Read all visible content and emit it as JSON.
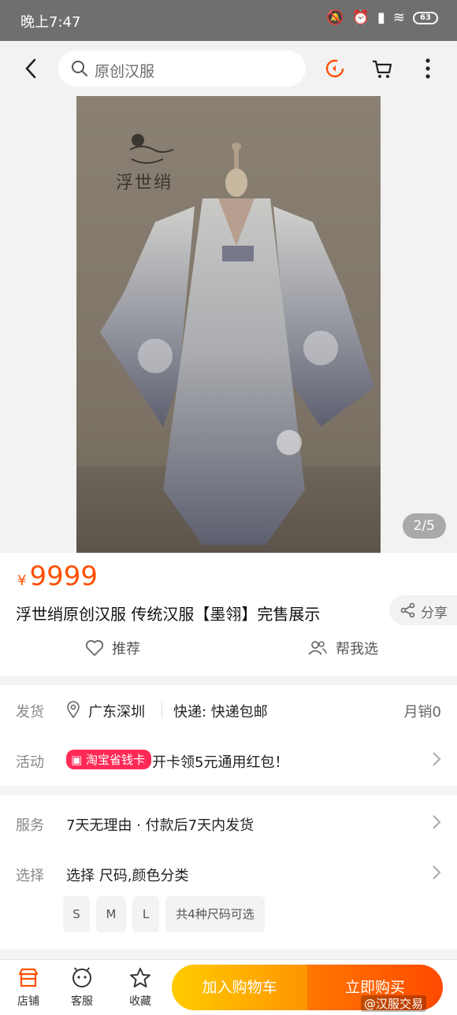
{
  "status": {
    "time": "晚上7:47",
    "battery": "63"
  },
  "search": {
    "placeholder": "原创汉服"
  },
  "hero": {
    "logo_text": "浮世绡",
    "pager": "2/5"
  },
  "product": {
    "price_symbol": "¥",
    "price": "9999",
    "title": "浮世绡原创汉服 传统汉服【墨翎】完售展示",
    "share": "分享",
    "recommend": "推荐",
    "help_choose": "帮我选"
  },
  "shipping": {
    "label": "发货",
    "location": "广东深圳",
    "express": "快递: 快递包邮",
    "monthly_sales": "月销0"
  },
  "promo": {
    "label": "活动",
    "tag": "淘宝省钱卡",
    "text": "开卡领5元通用红包！"
  },
  "service": {
    "label": "服务",
    "text": "7天无理由 · 付款后7天内发货"
  },
  "select": {
    "label": "选择",
    "text": "选择 尺码,颜色分类",
    "sizes": [
      "S",
      "M",
      "L"
    ],
    "more": "共4种尺码可选"
  },
  "bottom": {
    "store": "店铺",
    "service": "客服",
    "favorite": "收藏",
    "add_cart": "加入购物车",
    "buy_now": "立即购买"
  },
  "watermark": "@汉服交易",
  "colors": {
    "accent": "#ff5000",
    "cart": "#ffa300",
    "buy": "#ff5500",
    "tag": "#ff2a55"
  }
}
